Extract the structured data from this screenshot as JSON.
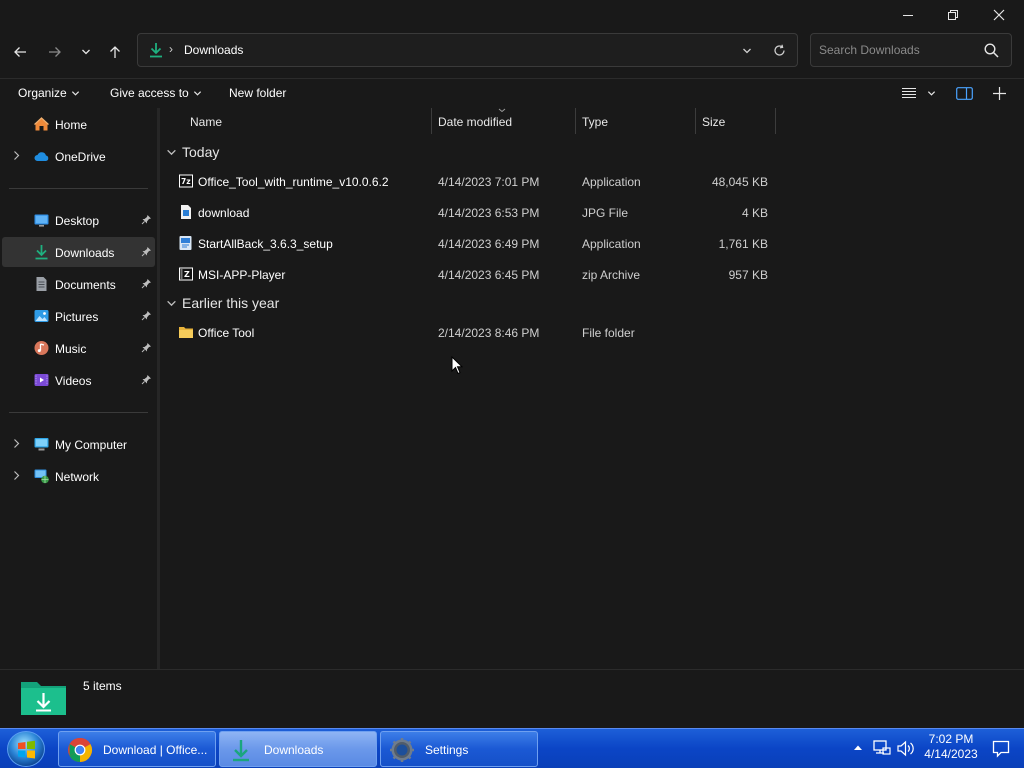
{
  "window": {
    "minimize_icon": "minimize-icon",
    "restore_icon": "restore-icon",
    "close_icon": "close-icon"
  },
  "address": {
    "location": "Downloads",
    "search_placeholder": "Search Downloads"
  },
  "toolbar": {
    "organize": "Organize",
    "give_access": "Give access to",
    "new_folder": "New folder"
  },
  "sidebar": {
    "items": [
      {
        "label": "Home",
        "icon": "home-icon"
      },
      {
        "label": "OneDrive",
        "icon": "cloud-icon"
      },
      {
        "label": "Desktop",
        "icon": "desktop-icon"
      },
      {
        "label": "Downloads",
        "icon": "download-icon"
      },
      {
        "label": "Documents",
        "icon": "document-icon"
      },
      {
        "label": "Pictures",
        "icon": "pictures-icon"
      },
      {
        "label": "Music",
        "icon": "music-icon"
      },
      {
        "label": "Videos",
        "icon": "videos-icon"
      },
      {
        "label": "My Computer",
        "icon": "computer-icon"
      },
      {
        "label": "Network",
        "icon": "network-icon"
      }
    ]
  },
  "columns": {
    "name": "Name",
    "date": "Date modified",
    "type": "Type",
    "size": "Size"
  },
  "groups": [
    {
      "label": "Today",
      "files": [
        {
          "name": "Office_Tool_with_runtime_v10.0.6.2",
          "date": "4/14/2023 7:01 PM",
          "type": "Application",
          "size": "48,045 KB",
          "icon": "7zip-app-icon"
        },
        {
          "name": "download",
          "date": "4/14/2023 6:53 PM",
          "type": "JPG File",
          "size": "4 KB",
          "icon": "image-file-icon"
        },
        {
          "name": "StartAllBack_3.6.3_setup",
          "date": "4/14/2023 6:49 PM",
          "type": "Application",
          "size": "1,761 KB",
          "icon": "setup-app-icon"
        },
        {
          "name": "MSI-APP-Player",
          "date": "4/14/2023 6:45 PM",
          "type": "zip Archive",
          "size": "957 KB",
          "icon": "zip-archive-icon"
        }
      ]
    },
    {
      "label": "Earlier this year",
      "files": [
        {
          "name": "Office Tool",
          "date": "2/14/2023 8:46 PM",
          "type": "File folder",
          "size": "",
          "icon": "folder-icon"
        }
      ]
    }
  ],
  "status": {
    "count": "5 items"
  },
  "taskbar": {
    "buttons": [
      {
        "label": "Download | Office...",
        "icon": "chrome-icon"
      },
      {
        "label": "Downloads",
        "icon": "explorer-download-icon"
      },
      {
        "label": "Settings",
        "icon": "settings-gear-icon"
      }
    ],
    "time": "7:02 PM",
    "date": "4/14/2023"
  },
  "colors": {
    "background": "#191919",
    "accent_green": "#1fb07f",
    "taskbar_blue": "#1550c8"
  }
}
